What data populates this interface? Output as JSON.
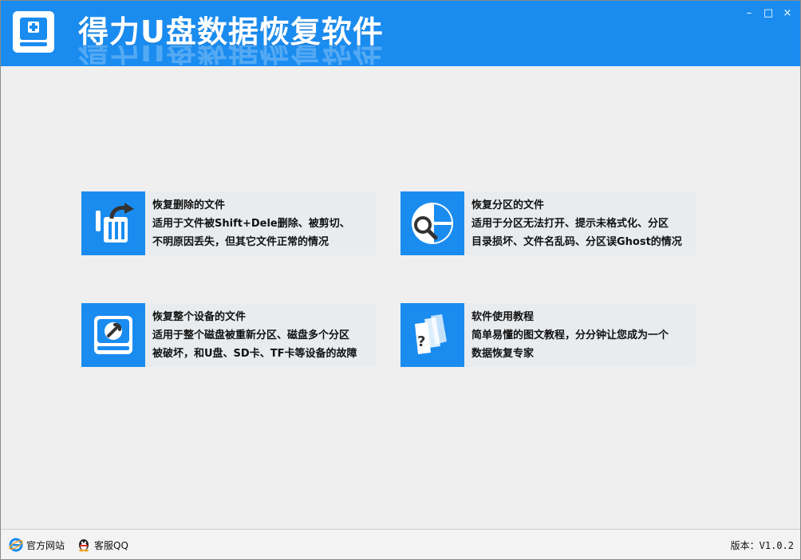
{
  "app": {
    "title": "得力U盘数据恢复软件",
    "brand_color": "#1a8cf0"
  },
  "window_controls": {
    "minimize": "–",
    "maximize": "□",
    "close": "×"
  },
  "cards": [
    {
      "icon": "trash-restore-icon",
      "title": "恢复删除的文件",
      "line1": "适用于文件被Shift+Dele删除、被剪切、",
      "line2": "不明原因丢失，但其它文件正常的情况"
    },
    {
      "icon": "partition-search-icon",
      "title": "恢复分区的文件",
      "line1": "适用于分区无法打开、提示未格式化、分区",
      "line2": "目录损坏、文件名乱码、分区误Ghost的情况"
    },
    {
      "icon": "disk-wrench-icon",
      "title": "恢复整个设备的文件",
      "line1": "适用于整个磁盘被重新分区、磁盘多个分区",
      "line2": "被破坏，和U盘、SD卡、TF卡等设备的故障"
    },
    {
      "icon": "tutorial-help-icon",
      "title": "软件使用教程",
      "line1": "简单易懂的图文教程，分分钟让您成为一个",
      "line2": "数据恢复专家"
    }
  ],
  "footer": {
    "website_label": "官方网站",
    "qq_label": "客服QQ",
    "version": "版本：V1.0.2"
  }
}
